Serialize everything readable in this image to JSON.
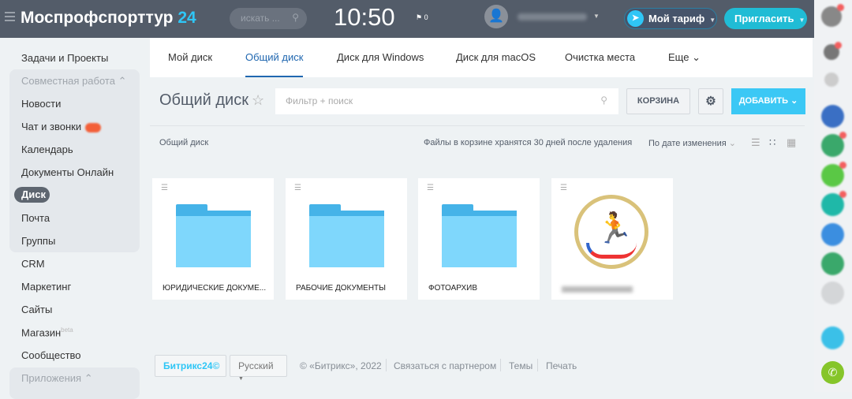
{
  "header": {
    "logo_name": "Моспрофспорттур",
    "logo_suffix": "24",
    "search_placeholder": "искать ...",
    "clock": "10:50",
    "flag_count": "0",
    "tariff_label": "Мой тариф",
    "invite_label": "Пригласить"
  },
  "sidebar": {
    "items": [
      "Задачи и Проекты",
      "Совместная работа",
      "Новости",
      "Чат и звонки",
      "Календарь",
      "Документы Онлайн",
      "Диск",
      "Почта",
      "Группы",
      "CRM",
      "Маркетинг",
      "Сайты",
      "Магазин",
      "Сообщество",
      "Приложения"
    ],
    "beta": "beta"
  },
  "tabs": [
    "Мой диск",
    "Общий диск",
    "Диск для Windows",
    "Диск для macOS",
    "Очистка места",
    "Еще"
  ],
  "toolbar": {
    "title": "Общий диск",
    "filter_placeholder": "Фильтр + поиск",
    "trash": "КОРЗИНА",
    "add": "ДОБАВИТЬ"
  },
  "infobar": {
    "breadcrumb": "Общий диск",
    "note": "Файлы в корзине хранятся 30 дней после удаления",
    "sort": "По дате изменения"
  },
  "files": [
    {
      "name": "ЮРИДИЧЕСКИЕ ДОКУМЕ..."
    },
    {
      "name": "РАБОЧИЕ ДОКУМЕНТЫ"
    },
    {
      "name": "ФОТОАРХИВ"
    },
    {
      "name": "МОСПРОФСПОРТТУР",
      "type": "image"
    }
  ],
  "footer": {
    "brand": "Битрикс24",
    "language": "Русский",
    "copyright": "© «Битрикс», 2022",
    "links": [
      "Связаться с партнером",
      "Темы",
      "Печать"
    ]
  }
}
